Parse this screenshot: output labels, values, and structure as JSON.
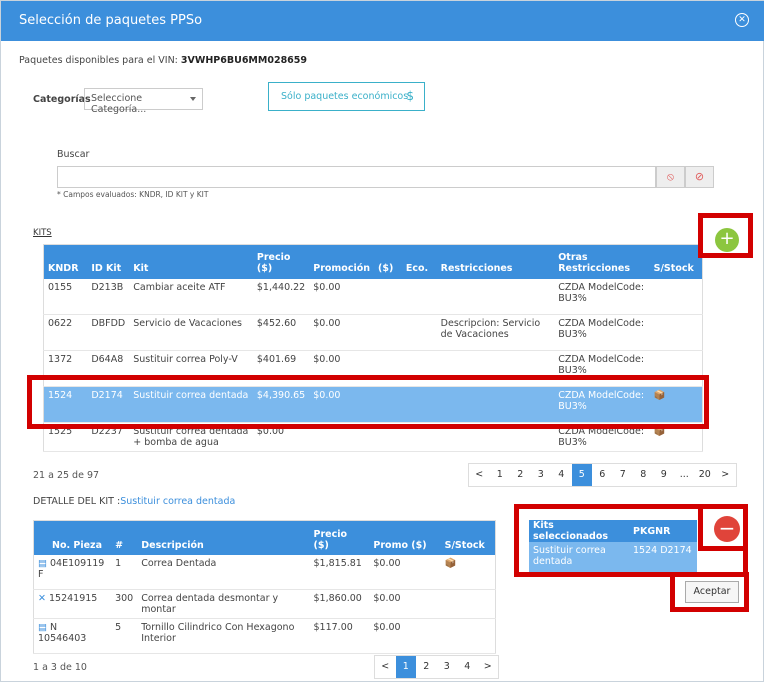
{
  "modal": {
    "title": "Selección de paquetes PPSo",
    "close_icon": "close-icon"
  },
  "vin": {
    "label": "Paquetes disponibles para el VIN:",
    "value": "3VWHP6BU6MM028659"
  },
  "categorias": {
    "label": "Categorías",
    "placeholder": "Seleccione Categoría..."
  },
  "eco_button": {
    "label": "Sólo paquetes económicos"
  },
  "search": {
    "label": "Buscar",
    "hint": "* Campos evaluados: KNDR, ID KIT y KIT"
  },
  "kits": {
    "label": "KITS",
    "headers": [
      "KNDR",
      "ID Kit",
      "Kit",
      "Precio ($)",
      "Promoción",
      "($)",
      "Eco.",
      "Restricciones",
      "Otras Restricciones",
      "S/Stock"
    ],
    "rows": [
      {
        "kndr": "0155",
        "id": "D213B",
        "kit": "Cambiar aceite ATF",
        "precio": "$1,440.22",
        "promo": "$0.00",
        "restr": "",
        "otras": "CZDA ModelCode: BU3%",
        "stock": false
      },
      {
        "kndr": "0622",
        "id": "DBFDD",
        "kit": "Servicio de Vacaciones",
        "precio": "$452.60",
        "promo": "$0.00",
        "restr": "Descripcion: Servicio de Vacaciones",
        "otras": "CZDA ModelCode: BU3%",
        "stock": false
      },
      {
        "kndr": "1372",
        "id": "D64A8",
        "kit": "Sustituir correa Poly-V",
        "precio": "$401.69",
        "promo": "$0.00",
        "restr": "",
        "otras": "CZDA ModelCode: BU3%",
        "stock": false
      },
      {
        "kndr": "1524",
        "id": "D2174",
        "kit": "Sustituir correa dentada",
        "precio": "$4,390.65",
        "promo": "$0.00",
        "restr": "",
        "otras": "CZDA ModelCode: BU3%",
        "stock": true
      },
      {
        "kndr": "1525",
        "id": "D2237",
        "kit": "Sustituir correa dentada + bomba de agua",
        "precio": "$0.00",
        "promo": "",
        "restr": "",
        "otras": "CZDA ModelCode: BU3%",
        "stock": true
      }
    ],
    "count": "21 a 25 de 97",
    "pages": [
      "<",
      "1",
      "2",
      "3",
      "4",
      "5",
      "6",
      "7",
      "8",
      "9",
      "...",
      "20",
      ">"
    ],
    "active_page": "5"
  },
  "detalle": {
    "label": "DETALLE DEL KIT :",
    "kit_name": "Sustituir correa dentada",
    "headers": [
      "No. Pieza",
      "#",
      "Descripción",
      "Precio ($)",
      "Promo ($)",
      "S/Stock"
    ],
    "rows": [
      {
        "pieza": "04E109119 F",
        "n": "1",
        "desc": "Correa Dentada",
        "precio": "$1,815.81",
        "promo": "$0.00"
      },
      {
        "pieza": "15241915",
        "n": "300",
        "desc": "Correa dentada desmontar y montar",
        "precio": "$1,860.00",
        "promo": "$0.00"
      },
      {
        "pieza": "N 10546403",
        "n": "5",
        "desc": "Tornillo Cilindrico Con Hexagono Interior",
        "precio": "$117.00",
        "promo": "$0.00"
      }
    ],
    "count": "1 a 3 de 10",
    "pages": [
      "<",
      "1",
      "2",
      "3",
      "4",
      ">"
    ],
    "active_page": "1"
  },
  "seleccionados": {
    "headers": [
      "Kits seleccionados",
      "PKGNR"
    ],
    "row": {
      "kit": "Sustituir correa dentada",
      "pkg": "1524 D2174"
    }
  },
  "aceptar": "Aceptar",
  "colors": {
    "header": "#3c8fdc",
    "selected": "#7bb8ee",
    "highlight": "#d20000",
    "add": "#8cc63f",
    "remove": "#e0443a"
  }
}
